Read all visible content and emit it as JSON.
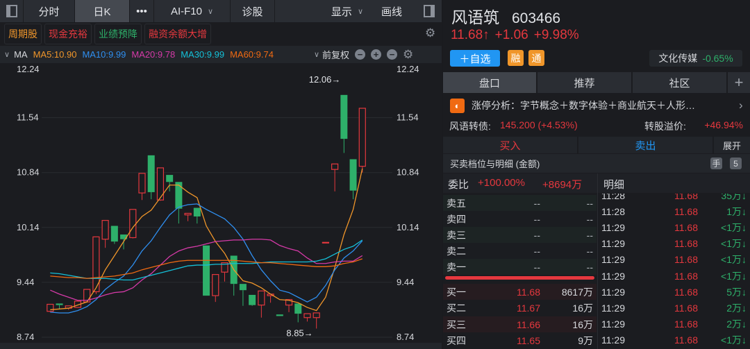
{
  "toolbar": {
    "tabs": [
      "分时",
      "日K",
      "•••",
      "AI-F10",
      "诊股"
    ],
    "display": "显示",
    "draw": "画线"
  },
  "tags": [
    {
      "label": "周期股",
      "color": "#f0962a"
    },
    {
      "label": "现金充裕",
      "color": "#e5383e"
    },
    {
      "label": "业绩预降",
      "color": "#2eb06a"
    },
    {
      "label": "融资余额大增",
      "color": "#e5383e"
    }
  ],
  "ma_row": {
    "label": "MA",
    "items": [
      {
        "label": "MA5:10.90",
        "color": "#f0962a"
      },
      {
        "label": "MA10:9.99",
        "color": "#2f8ff0"
      },
      {
        "label": "MA20:9.78",
        "color": "#d63aa8"
      },
      {
        "label": "MA30:9.99",
        "color": "#14c0d8"
      },
      {
        "label": "MA60:9.74",
        "color": "#f06a12"
      }
    ],
    "adjust": "前复权"
  },
  "chart_data": {
    "type": "candlestick",
    "yticks": [
      12.24,
      11.54,
      10.84,
      10.14,
      9.44,
      8.74
    ],
    "ylim": [
      8.74,
      12.24
    ],
    "annotations": [
      {
        "label": "12.06→",
        "price": 12.06,
        "index": 32
      },
      {
        "label": "8.85→",
        "price": 8.85,
        "index": 29
      }
    ],
    "candles": [
      [
        9.07,
        9.16,
        9.19,
        9.06
      ],
      [
        9.17,
        9.15,
        9.24,
        9.1
      ],
      [
        9.11,
        9.14,
        9.17,
        9.09
      ],
      [
        9.12,
        9.2,
        9.27,
        9.12
      ],
      [
        9.19,
        9.35,
        9.38,
        9.18
      ],
      [
        9.32,
        10.02,
        10.16,
        9.29
      ],
      [
        9.99,
        10.23,
        10.34,
        9.88
      ],
      [
        10.16,
        9.96,
        10.27,
        9.93
      ],
      [
        10.05,
        9.99,
        10.12,
        9.86
      ],
      [
        10.01,
        10.37,
        10.37,
        10.0
      ],
      [
        10.58,
        10.83,
        10.86,
        10.49
      ],
      [
        11.06,
        10.59,
        11.09,
        10.5
      ],
      [
        10.49,
        10.9,
        11.26,
        10.48
      ],
      [
        10.81,
        10.72,
        10.96,
        10.6
      ],
      [
        10.72,
        10.38,
        10.75,
        10.19
      ],
      [
        10.3,
        10.32,
        10.46,
        10.22
      ],
      [
        10.39,
        10.28,
        10.44,
        10.19
      ],
      [
        9.91,
        9.27,
        10.02,
        9.27
      ],
      [
        9.27,
        9.54,
        9.69,
        9.19
      ],
      [
        9.57,
        9.69,
        9.76,
        9.45
      ],
      [
        9.78,
        9.42,
        9.81,
        9.27
      ],
      [
        9.42,
        9.34,
        9.61,
        9.14
      ],
      [
        9.28,
        9.15,
        9.41,
        9.14
      ],
      [
        9.15,
        9.33,
        9.57,
        8.99
      ],
      [
        9.27,
        9.29,
        9.41,
        9.18
      ],
      [
        9.03,
        9.01,
        9.33,
        9.01
      ],
      [
        9.15,
        9.22,
        9.24,
        9.06
      ],
      [
        9.17,
        9.04,
        9.24,
        8.93
      ],
      [
        8.99,
        9.04,
        9.17,
        8.94
      ],
      [
        8.99,
        9.05,
        9.16,
        8.85
      ],
      [
        9.95,
        9.95,
        9.95,
        9.95
      ],
      [
        10.88,
        10.95,
        10.95,
        10.6
      ],
      [
        11.83,
        11.27,
        12.05,
        11.09
      ],
      [
        11.01,
        10.61,
        11.57,
        10.5
      ],
      [
        10.92,
        11.66,
        11.66,
        10.84
      ]
    ],
    "series": [
      {
        "name": "MA5",
        "color": "#f0962a",
        "values": [
          9.09,
          9.1,
          9.11,
          9.15,
          9.19,
          9.37,
          9.6,
          9.78,
          9.96,
          10.14,
          10.28,
          10.36,
          10.52,
          10.68,
          10.68,
          10.59,
          10.52,
          10.16,
          9.96,
          9.81,
          9.6,
          9.46,
          9.43,
          9.37,
          9.29,
          9.22,
          9.21,
          9.18,
          9.12,
          9.08,
          9.25,
          9.63,
          10.05,
          10.37,
          10.89
        ]
      },
      {
        "name": "MA10",
        "color": "#2f8ff0",
        "values": [
          9.06,
          9.05,
          9.05,
          9.08,
          9.13,
          9.22,
          9.35,
          9.44,
          9.52,
          9.66,
          9.84,
          9.97,
          10.14,
          10.3,
          10.4,
          10.43,
          10.44,
          10.37,
          10.31,
          10.25,
          10.14,
          9.99,
          9.78,
          9.6,
          9.46,
          9.34,
          9.31,
          9.25,
          9.19,
          9.25,
          9.4,
          9.6,
          9.75,
          9.84,
          9.97
        ]
      },
      {
        "name": "MA20",
        "color": "#d63aa8",
        "values": [
          9.34,
          9.29,
          9.25,
          9.21,
          9.21,
          9.24,
          9.28,
          9.31,
          9.32,
          9.37,
          9.47,
          9.55,
          9.66,
          9.77,
          9.84,
          9.88,
          9.9,
          9.93,
          9.96,
          9.97,
          9.98,
          9.98,
          9.99,
          9.99,
          9.98,
          9.91,
          9.87,
          9.84,
          9.75,
          9.68,
          9.68,
          9.7,
          9.71,
          9.71,
          9.78
        ]
      },
      {
        "name": "MA30",
        "color": "#14c0d8",
        "values": [
          9.56,
          9.55,
          9.53,
          9.51,
          9.49,
          9.49,
          9.49,
          9.48,
          9.47,
          9.47,
          9.5,
          9.53,
          9.56,
          9.59,
          9.62,
          9.65,
          9.66,
          9.66,
          9.67,
          9.67,
          9.68,
          9.68,
          9.68,
          9.69,
          9.7,
          9.7,
          9.7,
          9.7,
          9.7,
          9.71,
          9.74,
          9.8,
          9.86,
          9.9,
          9.98
        ]
      },
      {
        "name": "MA60",
        "color": "#f06a12",
        "values": [
          9.52,
          9.51,
          9.5,
          9.5,
          9.49,
          9.5,
          9.51,
          9.52,
          9.54,
          9.56,
          9.6,
          9.63,
          9.66,
          9.69,
          9.71,
          9.72,
          9.72,
          9.72,
          9.72,
          9.72,
          9.72,
          9.71,
          9.7,
          9.69,
          9.69,
          9.68,
          9.67,
          9.66,
          9.65,
          9.64,
          9.64,
          9.65,
          9.68,
          9.7,
          9.74
        ]
      }
    ],
    "colors": {
      "up": "#e5383e",
      "down": "#2eb06a"
    }
  },
  "stock": {
    "name": "风语筑",
    "code": "603466",
    "price": "11.68↑",
    "change": "+1.06",
    "pct": "+9.98%",
    "watch": "＋自选",
    "badge1": "融",
    "badge2": "通",
    "sector": "文化传媒",
    "sector_pct": "-0.65%"
  },
  "tabs": [
    "盘口",
    "推荐",
    "社区",
    "+"
  ],
  "limit_up": {
    "text": "涨停分析：字节概念＋数字体验＋商业航天＋人形…",
    "arrow": "›"
  },
  "bond": {
    "label": "风语转债:",
    "value": "145.200 (+4.53%)",
    "premium_label": "转股溢价:",
    "premium": "+46.94%"
  },
  "trade": {
    "buy": "买入",
    "sell": "卖出",
    "expand": "展开"
  },
  "depth_title": "买卖档位与明细 (金额)",
  "depth_icons": [
    "手",
    "5"
  ],
  "order_book": {
    "ratio_label": "委比",
    "ratio": "+100.00%",
    "diff": "+8694万",
    "asks": [
      {
        "n": "卖五",
        "p": "--",
        "v": "--"
      },
      {
        "n": "卖四",
        "p": "--",
        "v": "--"
      },
      {
        "n": "卖三",
        "p": "--",
        "v": "--"
      },
      {
        "n": "卖二",
        "p": "--",
        "v": "--"
      },
      {
        "n": "卖一",
        "p": "--",
        "v": "--"
      }
    ],
    "bids": [
      {
        "n": "买一",
        "p": "11.68",
        "v": "8617万"
      },
      {
        "n": "买二",
        "p": "11.67",
        "v": "16万"
      },
      {
        "n": "买三",
        "p": "11.66",
        "v": "16万"
      },
      {
        "n": "买四",
        "p": "11.65",
        "v": "9万"
      }
    ]
  },
  "details": {
    "title": "明细",
    "rows": [
      {
        "t": "11:28",
        "p": "11.68",
        "v": "35万↓"
      },
      {
        "t": "11:28",
        "p": "11.68",
        "v": "1万↓"
      },
      {
        "t": "11:29",
        "p": "11.68",
        "v": "<1万↓"
      },
      {
        "t": "11:29",
        "p": "11.68",
        "v": "<1万↓"
      },
      {
        "t": "11:29",
        "p": "11.68",
        "v": "<1万↓"
      },
      {
        "t": "11:29",
        "p": "11.68",
        "v": "<1万↓"
      },
      {
        "t": "11:29",
        "p": "11.68",
        "v": "5万↓"
      },
      {
        "t": "11:29",
        "p": "11.68",
        "v": "2万↓"
      },
      {
        "t": "11:29",
        "p": "11.68",
        "v": "2万↓"
      },
      {
        "t": "11:29",
        "p": "11.68",
        "v": "<1万↓"
      }
    ]
  }
}
